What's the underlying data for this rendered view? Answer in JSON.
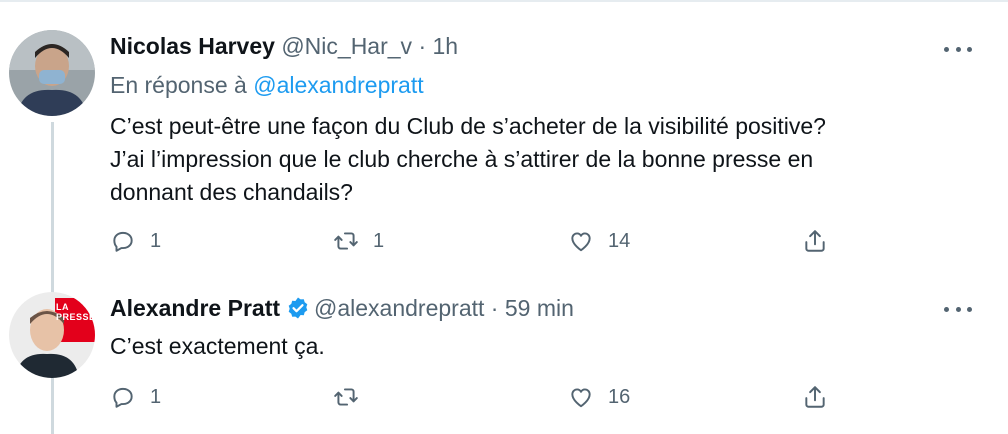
{
  "tweets": [
    {
      "name": "Nicolas Harvey",
      "handle": "@Nic_Har_v",
      "separator": "·",
      "time": "1h",
      "reply_prefix": "En réponse à",
      "reply_handle": "@alexandrepratt",
      "text_lines": [
        "C’est peut-être une façon du Club de s’acheter de la visibilité positive?",
        "J’ai l’impression que le club cherche à s’attirer de la bonne presse en",
        "donnant des chandails?"
      ],
      "replies": "1",
      "retweets": "1",
      "likes": "14"
    },
    {
      "name": "Alexandre Pratt",
      "verified": true,
      "handle": "@alexandrepratt",
      "separator": "·",
      "time": "59 min",
      "avatar_badge": "LA PRESSE",
      "text_lines": [
        "C’est exactement ça."
      ],
      "replies": "1",
      "retweets": "",
      "likes": "16"
    }
  ],
  "colors": {
    "text": "#0f1419",
    "secondary": "#536471",
    "link": "#1d9bf0",
    "verified": "#1d9bf0",
    "thread_line": "#cfd9de",
    "badge_red": "#e3001b"
  },
  "icons": [
    "reply-icon",
    "retweet-icon",
    "like-icon",
    "share-icon",
    "more-icon",
    "verified-icon"
  ]
}
